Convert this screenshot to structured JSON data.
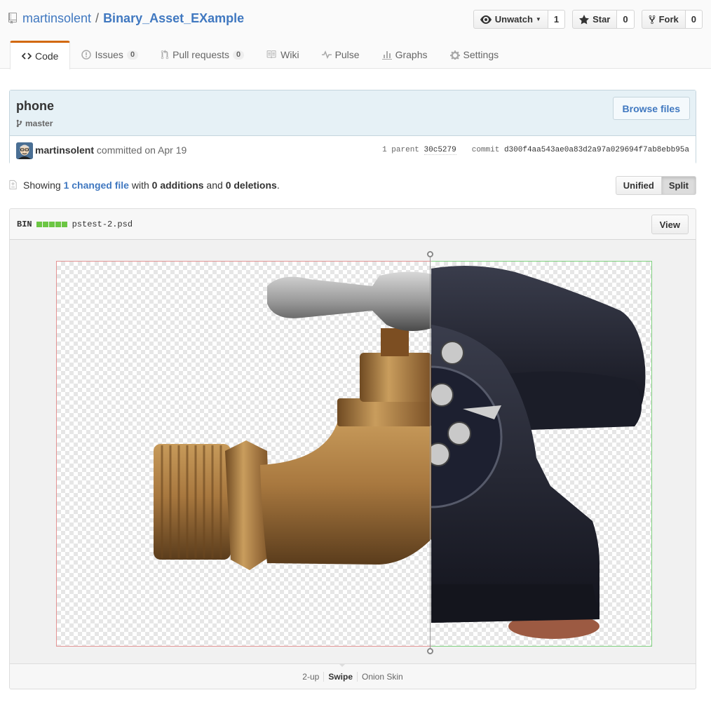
{
  "repo": {
    "owner": "martinsolent",
    "separator": "/",
    "name": "Binary_Asset_EXample"
  },
  "actions": {
    "watch_label": "Unwatch",
    "watch_count": "1",
    "star_label": "Star",
    "star_count": "0",
    "fork_label": "Fork",
    "fork_count": "0"
  },
  "nav": {
    "code": "Code",
    "issues": "Issues",
    "issues_count": "0",
    "pulls": "Pull requests",
    "pulls_count": "0",
    "wiki": "Wiki",
    "pulse": "Pulse",
    "graphs": "Graphs",
    "settings": "Settings"
  },
  "commit": {
    "title": "phone",
    "branch": "master",
    "browse_label": "Browse files",
    "author": "martinsolent",
    "action_text": " committed on Apr 19",
    "parent_label": "1 parent",
    "parent_sha": "30c5279",
    "commit_label": "commit",
    "commit_sha": "d300f4aa543ae0a83d2a97a029694f7ab8ebb95a"
  },
  "toc": {
    "showing": "Showing ",
    "changed_files": "1 changed file",
    "with": " with ",
    "additions": "0 additions",
    "and": " and ",
    "deletions": "0 deletions",
    "end": ".",
    "unified_label": "Unified",
    "split_label": "Split"
  },
  "file": {
    "bin_label": "BIN",
    "filename": "pstest-2.psd",
    "view_label": "View",
    "diffstat_blocks": 5
  },
  "view_modes": {
    "two_up": "2-up",
    "swipe": "Swipe",
    "onion": "Onion Skin",
    "active": "swipe"
  },
  "colors": {
    "link": "#4078c0",
    "nav_accent": "#d26911",
    "addition": "#6cc644",
    "deleted_border": "#e39494",
    "added_border": "#7fd17f"
  }
}
